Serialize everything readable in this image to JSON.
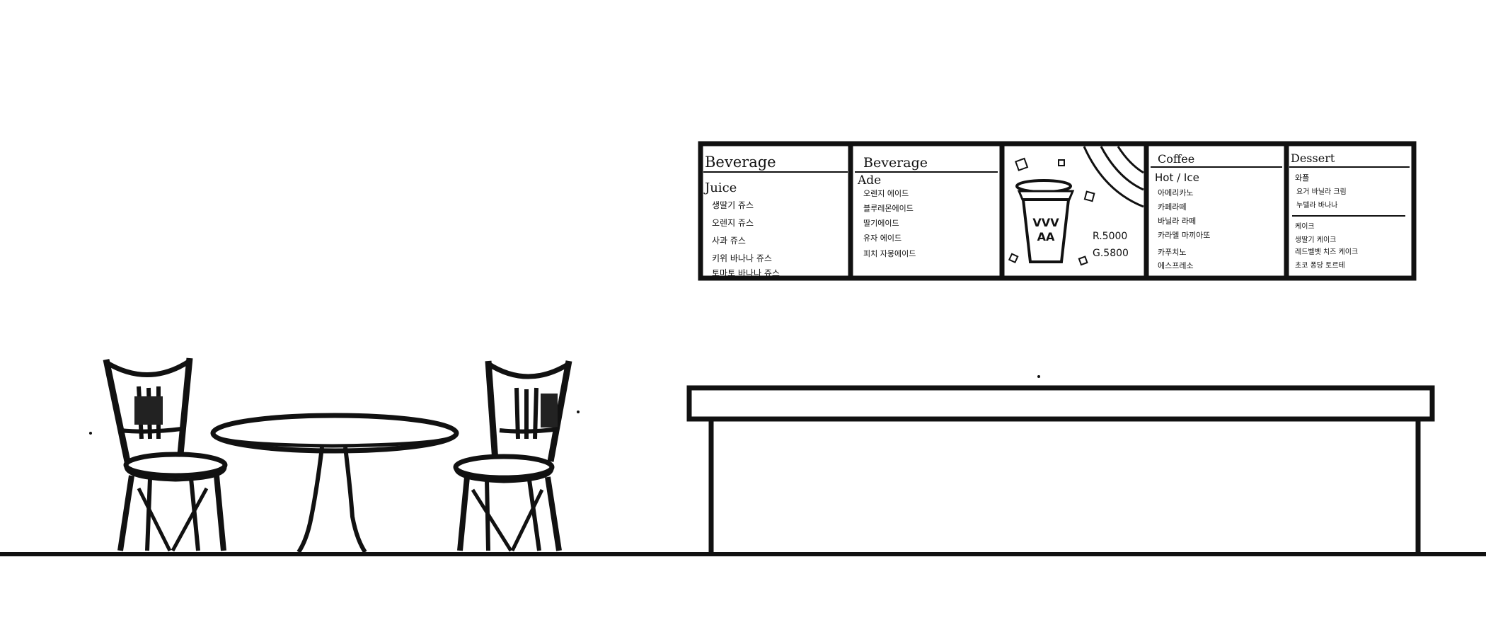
{
  "menu_board": {
    "panels": [
      {
        "title": "Beverage",
        "subtitle": "Juice",
        "items": [
          "생딸기 쥬스",
          "오렌지 쥬스",
          "사과 쥬스",
          "키위 바나나 쥬스",
          "토마토 바나나 쥬스"
        ]
      },
      {
        "title": "Beverage",
        "subtitle": "Ade",
        "items": [
          "오렌지 에이드",
          "블루레몬에이드",
          "딸기에이드",
          "유자 에이드",
          "피치 자몽에이드"
        ]
      },
      {
        "type": "image",
        "cup_logo": "VVV\nAA",
        "prices": [
          "R.5000",
          "G.5800"
        ]
      },
      {
        "title": "Coffee",
        "subtitle": "Hot / Ice",
        "items": [
          "아메리카노",
          "카페라떼",
          "바닐라 라떼",
          "카라멜 마끼아또",
          "카푸치노",
          "에스프레소"
        ]
      },
      {
        "title": "Dessert",
        "group1": [
          "와플",
          "요거 바닐라 크림",
          "누텔라 바나나"
        ],
        "group2": [
          "케이크",
          "생딸기 케이크",
          "레드벨벳 치즈 케이크",
          "초코 퐁당 토르테"
        ]
      }
    ]
  },
  "icons": {
    "chairs": "chair-icon",
    "table": "round-table-icon",
    "counter": "counter-icon",
    "cup": "coffee-cup-icon"
  },
  "colors": {
    "ink": "#111111",
    "background": "#ffffff"
  }
}
